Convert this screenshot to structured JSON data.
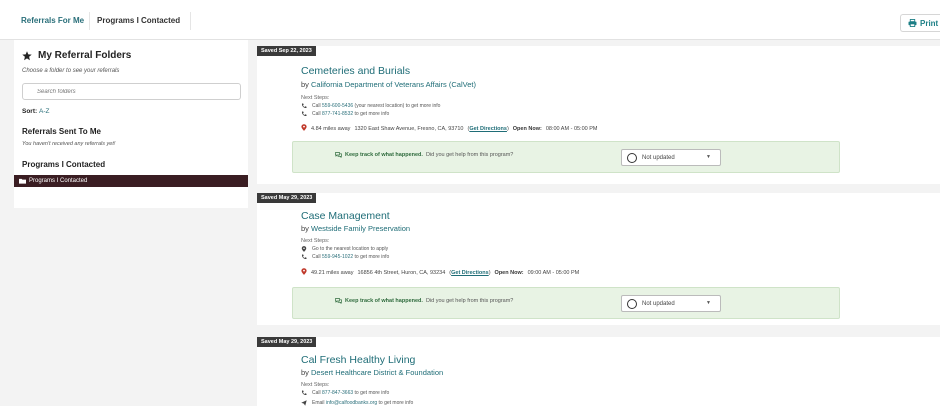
{
  "tabs": {
    "referrals_for_me": "Referrals For Me",
    "programs_contacted": "Programs I Contacted"
  },
  "print_label": "Print",
  "sidebar": {
    "title": "My Referral Folders",
    "hint": "Choose a folder to see your referrals",
    "search_placeholder": "Search folders",
    "sort_label": "Sort:",
    "sort_value": "A-Z",
    "sent_heading": "Referrals Sent To Me",
    "sent_empty": "You haven't received any referrals yet!",
    "contacted_heading": "Programs I Contacted",
    "active_folder": "Programs I Contacted"
  },
  "cards": [
    {
      "saved": "Saved Sep 22, 2023",
      "title": "Cemeteries and Burials",
      "by": "by",
      "org": "California Department of Veterans Affairs (CalVet)",
      "next_steps_label": "Next Steps:",
      "steps": [
        {
          "icon": "phone-icon",
          "pre": "Call ",
          "link": "559-600-5436",
          "post": " (your nearest location) to get more info"
        },
        {
          "icon": "phone-icon",
          "pre": "Call ",
          "link": "877-741-8532",
          "post": " to get more info"
        }
      ],
      "distance": "4.84 miles away",
      "address": "1320 East Shaw Avenue, Fresno, CA, 93710",
      "directions": "Get Directions",
      "open_label": "Open Now:",
      "hours": "08:00 AM - 05:00 PM",
      "track_strong": "Keep track of what happened.",
      "track_rest": "Did you get help from this program?",
      "status": "Not updated"
    },
    {
      "saved": "Saved May 29, 2023",
      "title": "Case Management",
      "by": "by",
      "org": "Westside Family Preservation",
      "next_steps_label": "Next Steps:",
      "steps": [
        {
          "icon": "pin-icon",
          "pre": "Go to the nearest location to apply",
          "link": "",
          "post": ""
        },
        {
          "icon": "phone-icon",
          "pre": "Call ",
          "link": "559-945-1022",
          "post": " to get more info"
        }
      ],
      "distance": "49.21 miles away",
      "address": "16856 4th Street, Huron, CA, 93234",
      "directions": "Get Directions",
      "open_label": "Open Now:",
      "hours": "09:00 AM - 05:00 PM",
      "track_strong": "Keep track of what happened.",
      "track_rest": "Did you get help from this program?",
      "status": "Not updated"
    },
    {
      "saved": "Saved May 29, 2023",
      "title": "Cal Fresh Healthy Living",
      "by": "by",
      "org": "Desert Healthcare District & Foundation",
      "next_steps_label": "Next Steps:",
      "steps": [
        {
          "icon": "phone-icon",
          "pre": "Call ",
          "link": "877-847-3663",
          "post": " to get more info"
        },
        {
          "icon": "send-icon",
          "pre": "Email ",
          "link": "info@calfoodbanks.org",
          "post": " to get more info"
        }
      ]
    }
  ],
  "colors": {
    "accent": "#1f6d77",
    "badge": "#3a3a3a",
    "active_folder_bg": "#3a1d22",
    "track_bg": "#e8f3e4"
  }
}
